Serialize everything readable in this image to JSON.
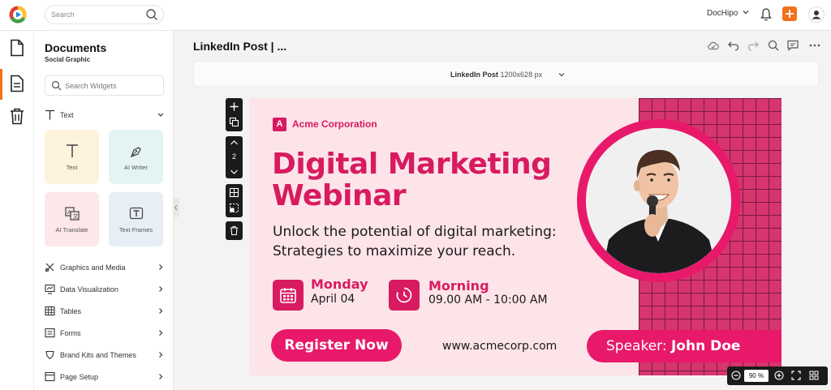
{
  "topbar": {
    "search_placeholder": "Search",
    "account_name": "DocHipo",
    "icons": [
      "app-logo-icon",
      "search-icon",
      "chevron-down-icon",
      "bell-icon",
      "plus-icon",
      "user-icon"
    ],
    "accent_color": "#f2711c"
  },
  "rail": {
    "items": [
      "documents-icon",
      "document-active-icon",
      "trash-icon"
    ]
  },
  "panel": {
    "title": "Documents",
    "subtitle": "Social Graphic",
    "search_placeholder": "Search Widgets",
    "text_section": "Text",
    "tiles": [
      {
        "label": "Text",
        "icon": "text-icon",
        "bg": "#fdf3dc"
      },
      {
        "label": "AI Writer",
        "icon": "pen-nib-icon",
        "bg": "#e3f4f3"
      },
      {
        "label": "AI Translate",
        "icon": "translate-icon",
        "bg": "#fde7e8"
      },
      {
        "label": "Text Frames",
        "icon": "text-frame-icon",
        "bg": "#e8eef6"
      }
    ],
    "sections": [
      {
        "label": "Graphics and Media",
        "icon": "graphics-icon"
      },
      {
        "label": "Data Visualization",
        "icon": "data-viz-icon"
      },
      {
        "label": "Tables",
        "icon": "table-icon"
      },
      {
        "label": "Forms",
        "icon": "form-icon"
      },
      {
        "label": "Brand Kits and Themes",
        "icon": "brand-kit-icon"
      },
      {
        "label": "Page Setup",
        "icon": "page-setup-icon"
      }
    ]
  },
  "editor": {
    "doc_title": "LinkedIn Post | ...",
    "toolbar_icons": [
      "cloud-save-icon",
      "undo-icon",
      "redo-icon",
      "search-icon",
      "comment-icon",
      "more-icon"
    ],
    "size_label": "LinkedIn Post",
    "size_value": "1200x628 px",
    "page_number": "2"
  },
  "design": {
    "brand_initial": "A",
    "brand_name": "Acme Corporation",
    "headline": "Digital Marketing Webinar",
    "subline": "Unlock the potential of digital marketing: Strategies to maximize your reach.",
    "day_label": "Monday",
    "date": "April 04",
    "time_label": "Morning",
    "time": "09.00 AM - 10:00 AM",
    "cta": "Register Now",
    "website": "www.acmecorp.com",
    "speaker_prefix": "Speaker:",
    "speaker_name": "John Doe",
    "colors": {
      "primary": "#d81b60",
      "button": "#e8196a",
      "background": "#fde4e9",
      "grid": "#d6356f"
    }
  },
  "zoom": {
    "value": "90",
    "unit": "%"
  }
}
